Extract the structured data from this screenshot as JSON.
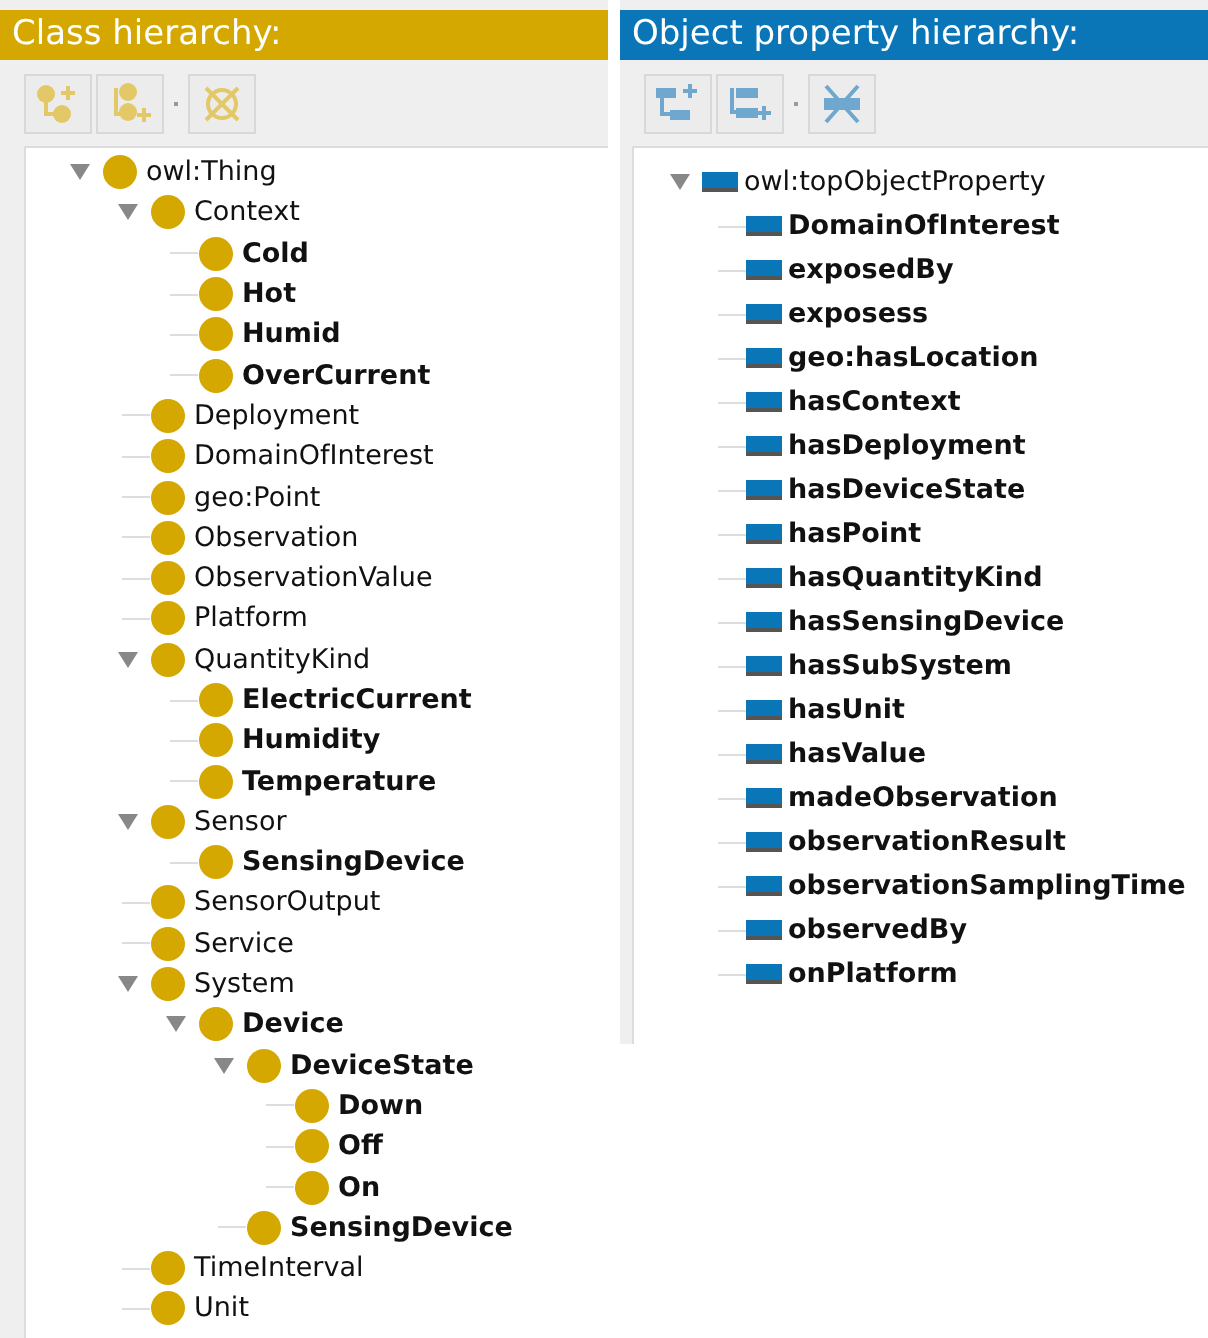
{
  "class_panel": {
    "title": "Class hierarchy:",
    "tree": [
      {
        "label": "owl:Thing",
        "bold": false,
        "expanded": true,
        "children": [
          {
            "label": "Context",
            "bold": false,
            "expanded": true,
            "children": [
              {
                "label": "Cold",
                "bold": true
              },
              {
                "label": "Hot",
                "bold": true
              },
              {
                "label": "Humid",
                "bold": true
              },
              {
                "label": "OverCurrent",
                "bold": true
              }
            ]
          },
          {
            "label": "Deployment",
            "bold": false
          },
          {
            "label": "DomainOfInterest",
            "bold": false
          },
          {
            "label": "geo:Point",
            "bold": false
          },
          {
            "label": "Observation",
            "bold": false
          },
          {
            "label": "ObservationValue",
            "bold": false
          },
          {
            "label": "Platform",
            "bold": false
          },
          {
            "label": "QuantityKind",
            "bold": false,
            "expanded": true,
            "children": [
              {
                "label": "ElectricCurrent",
                "bold": true
              },
              {
                "label": "Humidity",
                "bold": true
              },
              {
                "label": "Temperature",
                "bold": true
              }
            ]
          },
          {
            "label": "Sensor",
            "bold": false,
            "expanded": true,
            "children": [
              {
                "label": "SensingDevice",
                "bold": true
              }
            ]
          },
          {
            "label": "SensorOutput",
            "bold": false
          },
          {
            "label": "Service",
            "bold": false
          },
          {
            "label": "System",
            "bold": false,
            "expanded": true,
            "children": [
              {
                "label": "Device",
                "bold": true,
                "expanded": true,
                "children": [
                  {
                    "label": "DeviceState",
                    "bold": true,
                    "expanded": true,
                    "children": [
                      {
                        "label": "Down",
                        "bold": true
                      },
                      {
                        "label": "Off",
                        "bold": true
                      },
                      {
                        "label": "On",
                        "bold": true
                      }
                    ]
                  },
                  {
                    "label": "SensingDevice",
                    "bold": true
                  }
                ]
              }
            ]
          },
          {
            "label": "TimeInterval",
            "bold": false
          },
          {
            "label": "Unit",
            "bold": false
          }
        ]
      }
    ]
  },
  "property_panel": {
    "title": "Object property hierarchy:",
    "tree": [
      {
        "label": "owl:topObjectProperty",
        "bold": false,
        "expanded": true,
        "children": [
          {
            "label": "DomainOfInterest",
            "bold": true
          },
          {
            "label": "exposedBy",
            "bold": true
          },
          {
            "label": "exposess",
            "bold": true
          },
          {
            "label": "geo:hasLocation",
            "bold": true
          },
          {
            "label": "hasContext",
            "bold": true
          },
          {
            "label": "hasDeployment",
            "bold": true
          },
          {
            "label": "hasDeviceState",
            "bold": true
          },
          {
            "label": "hasPoint",
            "bold": true
          },
          {
            "label": "hasQuantityKind",
            "bold": true
          },
          {
            "label": "hasSensingDevice",
            "bold": true
          },
          {
            "label": "hasSubSystem",
            "bold": true
          },
          {
            "label": "hasUnit",
            "bold": true
          },
          {
            "label": "hasValue",
            "bold": true
          },
          {
            "label": "madeObservation",
            "bold": true
          },
          {
            "label": "observationResult",
            "bold": true
          },
          {
            "label": "observationSamplingTime",
            "bold": true
          },
          {
            "label": "observedBy",
            "bold": true
          },
          {
            "label": "onPlatform",
            "bold": true
          }
        ]
      }
    ]
  }
}
